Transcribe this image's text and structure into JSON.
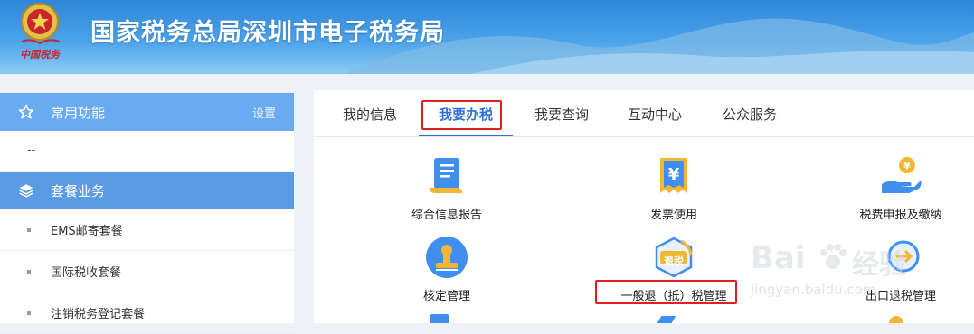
{
  "header": {
    "title": "国家税务总局深圳市电子税务局",
    "emblem_text": "中国税务"
  },
  "sidebar": {
    "sections": [
      {
        "label": "常用功能",
        "action": "设置",
        "icon": "star-icon"
      },
      {
        "label": "套餐业务",
        "icon": "layers-icon"
      }
    ],
    "empty_text": "--",
    "items": [
      {
        "label": "EMS邮寄套餐"
      },
      {
        "label": "国际税收套餐"
      },
      {
        "label": "注销税务登记套餐"
      }
    ]
  },
  "main": {
    "tabs": [
      {
        "label": "我的信息"
      },
      {
        "label": "我要办税",
        "active": true
      },
      {
        "label": "我要查询"
      },
      {
        "label": "互动中心"
      },
      {
        "label": "公众服务"
      }
    ],
    "services": [
      {
        "label": "综合信息报告",
        "icon": "document-report-icon"
      },
      {
        "label": "发票使用",
        "icon": "invoice-yuan-icon"
      },
      {
        "label": "税费申报及缴纳",
        "icon": "hand-coin-icon"
      },
      {
        "label": "核定管理",
        "icon": "stamp-icon"
      },
      {
        "label": "一般退（抵）税管理",
        "icon": "tax-refund-icon",
        "icon_text": "退税"
      },
      {
        "label": "出口退税管理",
        "icon": "export-refund-icon"
      }
    ]
  },
  "watermark": {
    "brand": "Bai",
    "brand_suffix": "经验",
    "url": "jingyan.baidu.com"
  },
  "colors": {
    "accent": "#2f6fd8",
    "highlight_box": "#e02020",
    "sidebar_header": "#6aaaf0"
  }
}
